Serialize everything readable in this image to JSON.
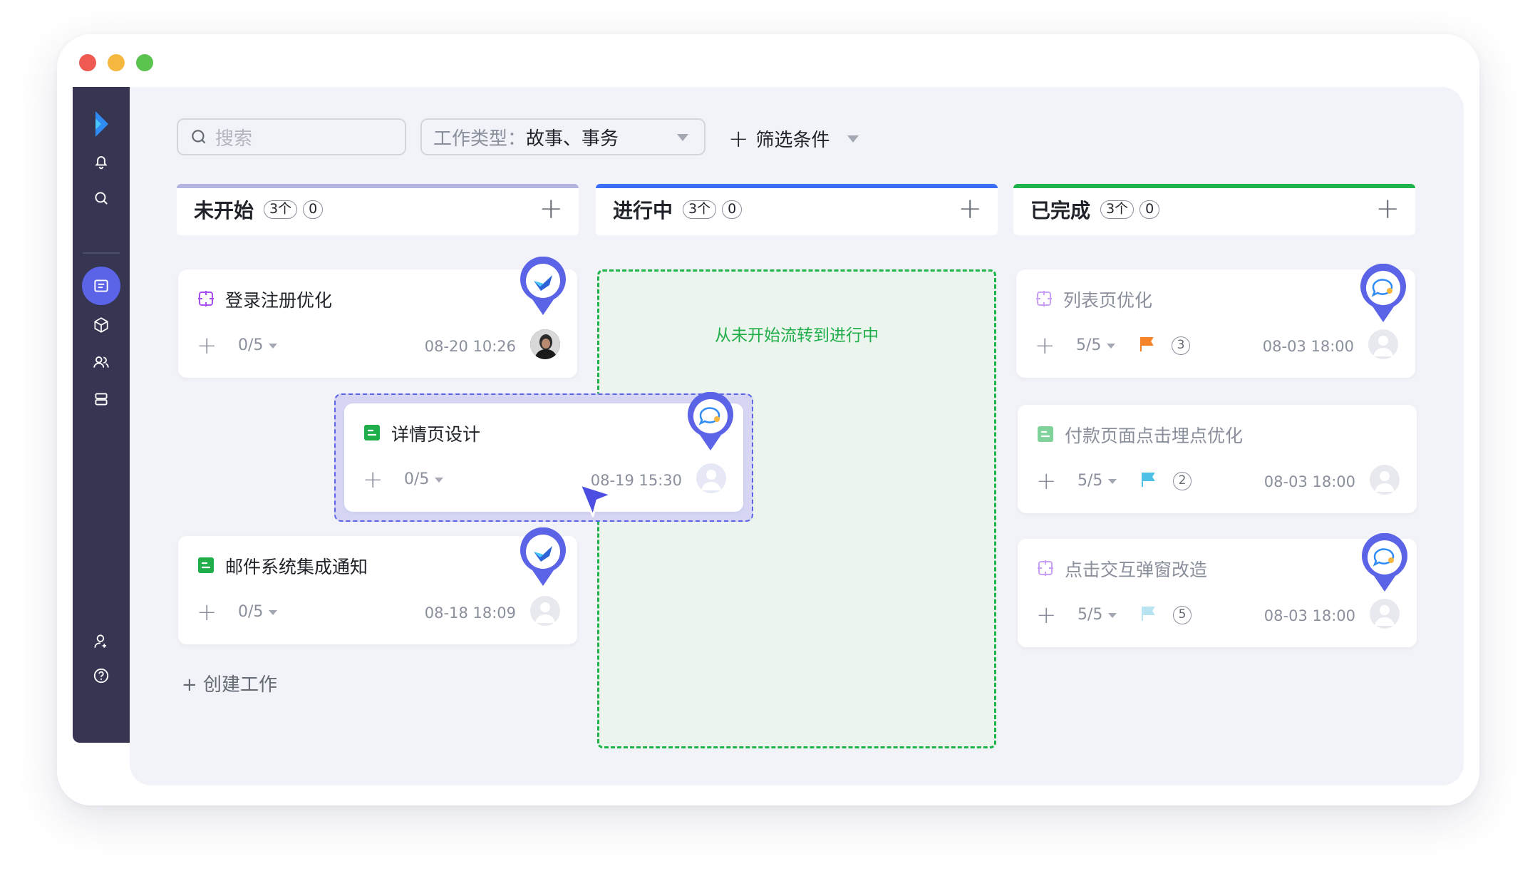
{
  "search": {
    "placeholder": "搜索"
  },
  "filter": {
    "label": "工作类型：",
    "value": "故事、事务",
    "add_label": "筛选条件"
  },
  "columns": [
    {
      "title": "未开始",
      "count": "3个",
      "badge": "0",
      "color": "#b3b5e0"
    },
    {
      "title": "进行中",
      "count": "3个",
      "badge": "0",
      "color": "#3b6ef5"
    },
    {
      "title": "已完成",
      "count": "3个",
      "badge": "0",
      "color": "#1fb34b"
    }
  ],
  "cards": {
    "c1": {
      "title": "登录注册优化",
      "progress": "0/5",
      "date": "08-20 10:26",
      "type_icon": "story-icon"
    },
    "c2": {
      "title": "详情页设计",
      "progress": "0/5",
      "date": "08-19 15:30",
      "type_icon": "task-icon"
    },
    "c3": {
      "title": "邮件系统集成通知",
      "progress": "0/5",
      "date": "08-18 18:09",
      "type_icon": "task-icon"
    },
    "c4": {
      "title": "列表页优化",
      "progress": "5/5",
      "date": "08-03 18:00",
      "priority": "3",
      "flag_color": "#f5832a"
    },
    "c5": {
      "title": "付款页面点击埋点优化",
      "progress": "5/5",
      "date": "08-03 18:00",
      "priority": "2",
      "flag_color": "#4fc1e6"
    },
    "c6": {
      "title": "点击交互弹窗改造",
      "progress": "5/5",
      "date": "08-03 18:00",
      "priority": "5",
      "flag_color": "#b8e4f2"
    }
  },
  "dropzone": {
    "message": "从未开始流转到进行中"
  },
  "create_label": "+ 创建工作",
  "colors": {
    "accent": "#5b63e6",
    "sidebar": "#363653",
    "success": "#1fb34b"
  }
}
